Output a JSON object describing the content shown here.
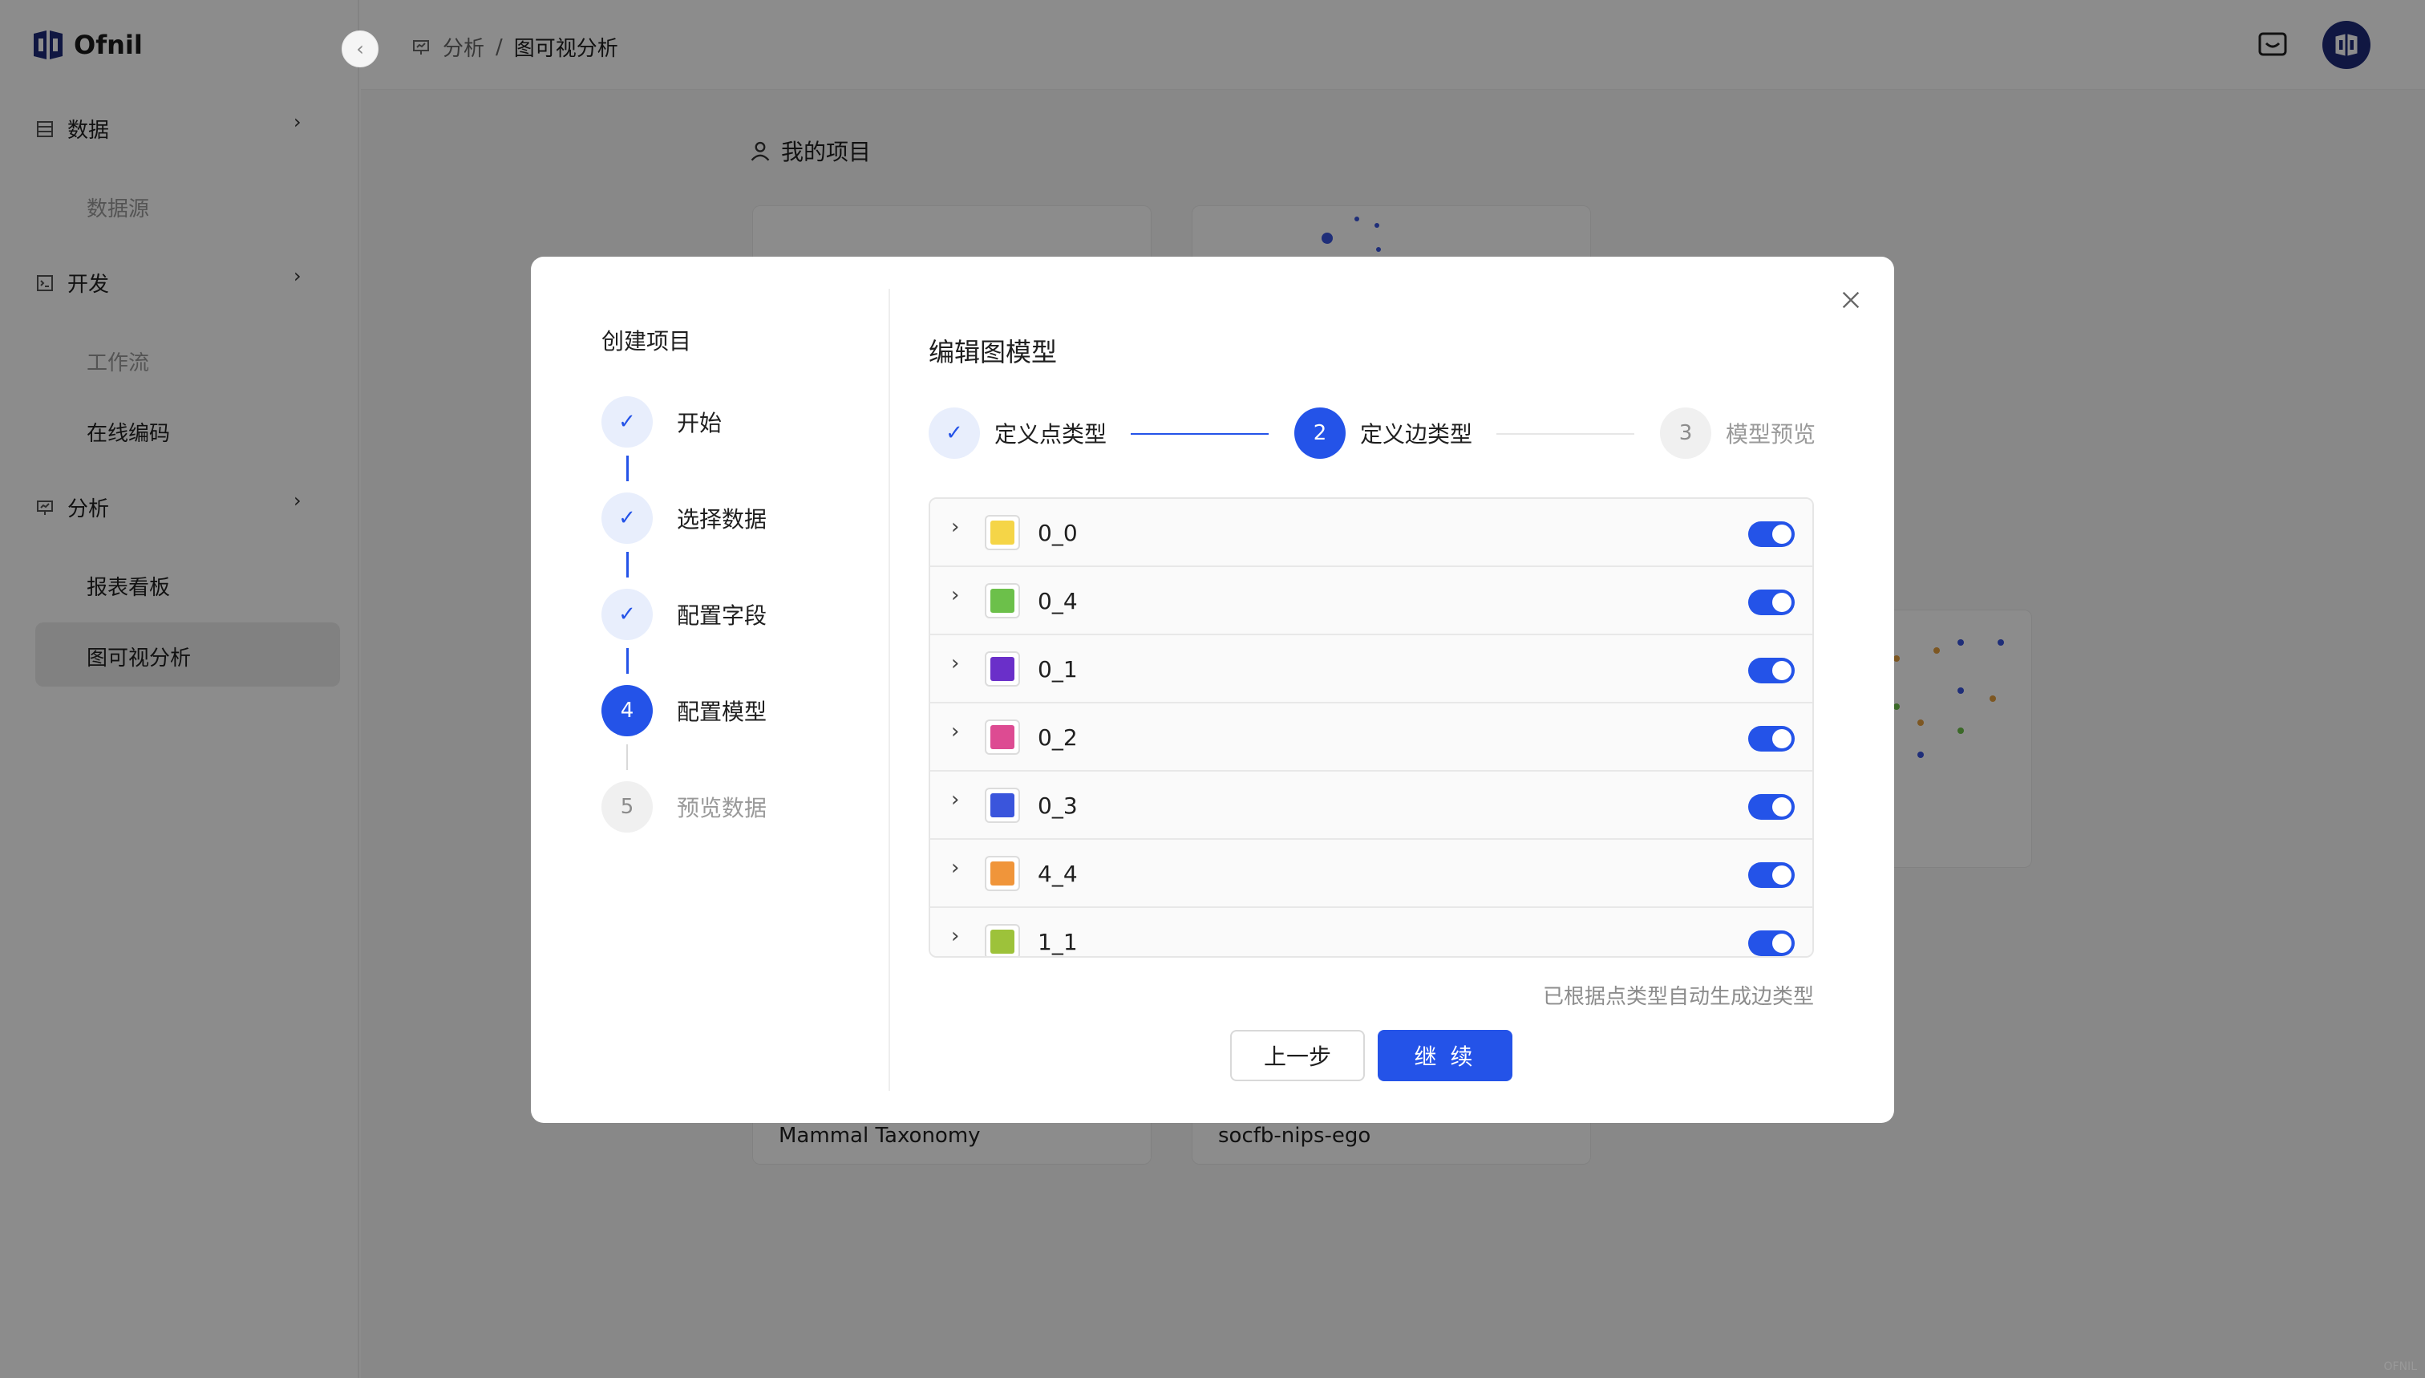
{
  "app": {
    "brand": "Ofnil"
  },
  "sidebar": {
    "groups": [
      {
        "label": "数据",
        "icon": "database-icon",
        "children": [
          "数据源"
        ]
      },
      {
        "label": "开发",
        "icon": "terminal-icon",
        "children": [
          "工作流",
          "在线编码"
        ]
      },
      {
        "label": "分析",
        "icon": "presentation-icon",
        "children": [
          "报表看板",
          "图可视分析"
        ]
      }
    ],
    "active_item": "图可视分析"
  },
  "breadcrumb": {
    "parent": "分析",
    "separator": "/",
    "current": "图可视分析"
  },
  "main": {
    "section_title": "我的项目",
    "cards": [
      {
        "title": "Mammal Taxonomy"
      },
      {
        "title": "socfb-nips-ego"
      }
    ]
  },
  "modal": {
    "wizard_title": "创建项目",
    "steps": [
      {
        "label": "开始",
        "state": "done",
        "number": "1"
      },
      {
        "label": "选择数据",
        "state": "done",
        "number": "2"
      },
      {
        "label": "配置字段",
        "state": "done",
        "number": "3"
      },
      {
        "label": "配置模型",
        "state": "current",
        "number": "4"
      },
      {
        "label": "预览数据",
        "state": "todo",
        "number": "5"
      }
    ],
    "content_title": "编辑图模型",
    "sub_steps": [
      {
        "label": "定义点类型",
        "state": "done",
        "number": "1"
      },
      {
        "label": "定义边类型",
        "state": "current",
        "number": "2"
      },
      {
        "label": "模型预览",
        "state": "todo",
        "number": "3"
      }
    ],
    "edge_types": [
      {
        "name": "0_0",
        "color": "#f5d547",
        "enabled": true
      },
      {
        "name": "0_4",
        "color": "#6cc04a",
        "enabled": true
      },
      {
        "name": "0_1",
        "color": "#6a2fc9",
        "enabled": true
      },
      {
        "name": "0_2",
        "color": "#dd4b92",
        "enabled": true
      },
      {
        "name": "0_3",
        "color": "#3a55dc",
        "enabled": true
      },
      {
        "name": "4_4",
        "color": "#f0953a",
        "enabled": true
      },
      {
        "name": "1_1",
        "color": "#9dc23a",
        "enabled": true
      }
    ],
    "hint": "已根据点类型自动生成边类型",
    "prev_label": "上一步",
    "next_label": "继 续"
  },
  "colors": {
    "accent": "#2453e8",
    "overlay": "rgba(0,0,0,0.45)"
  },
  "corner_text": "OFNIL"
}
